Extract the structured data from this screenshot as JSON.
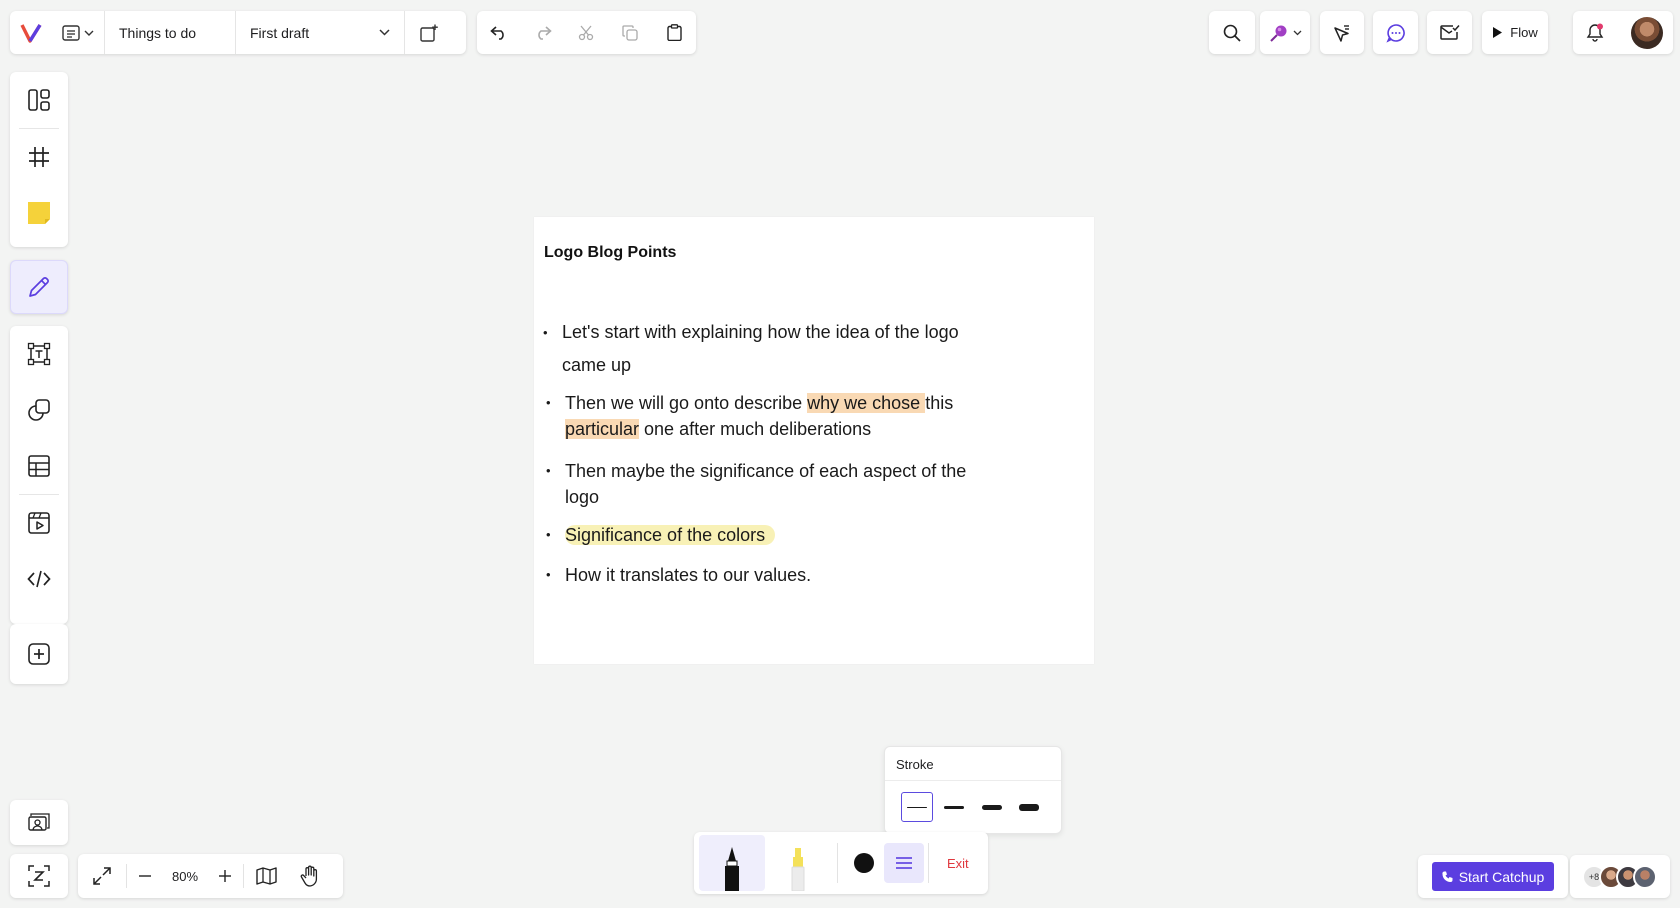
{
  "colors": {
    "accent": "#5b3ee0",
    "highlight_orange": "#f9d9b4",
    "highlight_yellow": "#f8f1b6",
    "exit": "#e0383e"
  },
  "topbar": {
    "doc_name": "Things to do",
    "page_select": "First draft"
  },
  "topright": {
    "flow_label": "Flow"
  },
  "document": {
    "title": "Logo Blog Points",
    "bullets": [
      {
        "text": "Let's start with explaining how the idea of the logo came up"
      },
      {
        "before": "Then we will go onto describe ",
        "hl1": "why we chose ",
        "mid": "this ",
        "hl2": "particular",
        "after": " one after much deliberations"
      },
      {
        "text": "Then maybe the significance of each aspect of the logo"
      },
      {
        "hl": "Significance of the colors"
      },
      {
        "text": "How it translates to our values."
      }
    ]
  },
  "stroke_popover": {
    "title": "Stroke",
    "options": [
      "thin",
      "medium",
      "thick",
      "extra-thick"
    ],
    "selected": "thin"
  },
  "draw_tools": {
    "exit_label": "Exit",
    "selected_tool": "pen",
    "color": "#111111"
  },
  "zoom": {
    "value": "80%"
  },
  "bottom_right": {
    "catchup_label": "Start Catchup",
    "collab_count": "+8"
  }
}
